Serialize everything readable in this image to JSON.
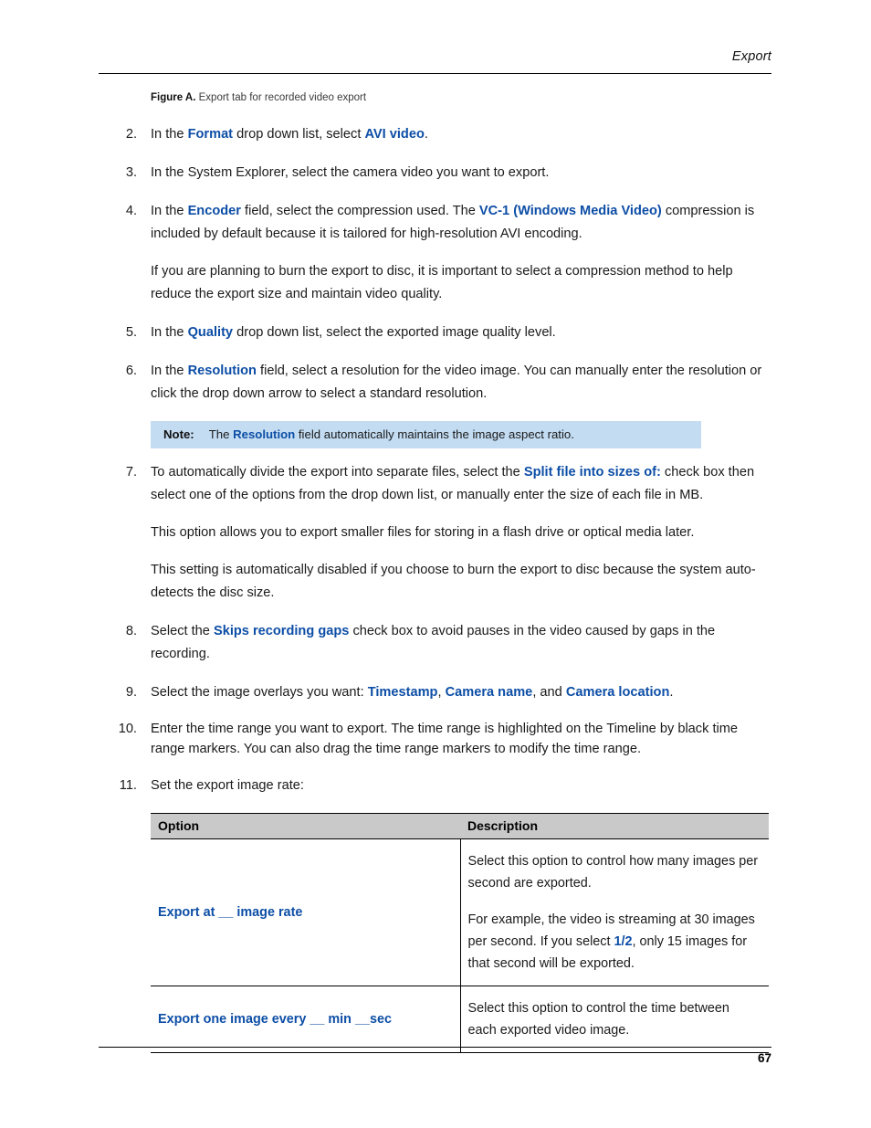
{
  "header": {
    "title": "Export"
  },
  "figure": {
    "label": "Figure A.",
    "caption": "Export tab for recorded video export"
  },
  "steps": {
    "s2": {
      "num": "2.",
      "t1": "In the ",
      "b1": "Format",
      "t2": " drop down list, select ",
      "b2": "AVI video",
      "t3": "."
    },
    "s3": {
      "num": "3.",
      "t1": "In the System Explorer, select the camera video you want to export."
    },
    "s4": {
      "num": "4.",
      "t1": "In the ",
      "b1": "Encoder",
      "t2": " field, select the compression used. The ",
      "b2": "VC-1 (Windows Media Video)",
      "t3": " compression is included by default because it is tailored for high-resolution AVI encoding.",
      "p2": "If you are planning to burn the export to disc, it is important to select a compression method to help reduce the export size and maintain video quality."
    },
    "s5": {
      "num": "5.",
      "t1": "In the ",
      "b1": "Quality",
      "t2": " drop down list, select the exported image quality level."
    },
    "s6": {
      "num": "6.",
      "t1": "In the ",
      "b1": "Resolution",
      "t2": " field, select a resolution for the video image. You can manually enter the resolution or click the drop down arrow to select a standard resolution."
    },
    "note": {
      "label": "Note:",
      "t1": "The ",
      "b1": "Resolution",
      "t2": " field automatically maintains the image aspect ratio."
    },
    "s7": {
      "num": "7.",
      "t1": "To automatically divide the export into separate files, select the ",
      "b1": "Split file into sizes of:",
      "t2": " check box then select one of the options from the drop down list, or manually enter the size of each file in MB.",
      "p2": "This option allows you to export smaller files for storing in a flash drive or optical media later.",
      "p3": "This setting is automatically disabled if you choose to burn the export to disc because the system auto-detects the disc size."
    },
    "s8": {
      "num": "8.",
      "t1": "Select the ",
      "b1": "Skips recording gaps",
      "t2": " check box to avoid pauses in the video caused by gaps in the recording."
    },
    "s9": {
      "num": "9.",
      "t1": "Select the image overlays you want: ",
      "b1": "Timestamp",
      "t2": ", ",
      "b2": "Camera name",
      "t3": ", and ",
      "b3": "Camera location",
      "t4": "."
    },
    "s10": {
      "num": "10.",
      "t1": "Enter the time range you want to export. The time range is highlighted on the Timeline by black time range markers. You can also drag the time range markers to modify the time range."
    },
    "s11": {
      "num": "11.",
      "t1": "Set the export image rate:"
    }
  },
  "table": {
    "headers": {
      "option": "Option",
      "description": "Description"
    },
    "rows": [
      {
        "option": "Export at __ image rate",
        "desc_p1": "Select this option to control how many images per second are exported.",
        "desc_p2_a": "For example, the video is streaming at 30 images per second. If you select ",
        "desc_p2_b": "1/2",
        "desc_p2_c": ", only 15 images for that second will be exported."
      },
      {
        "option": "Export one image every __ min __sec",
        "desc_p1": "Select this option to control the time between each exported video image."
      }
    ]
  },
  "footer": {
    "page_number": "67"
  },
  "colors": {
    "link_blue": "#0d4ea6",
    "note_background": "#c3dcf2",
    "table_header_background": "#c9c9c9",
    "rule": "#000000"
  }
}
